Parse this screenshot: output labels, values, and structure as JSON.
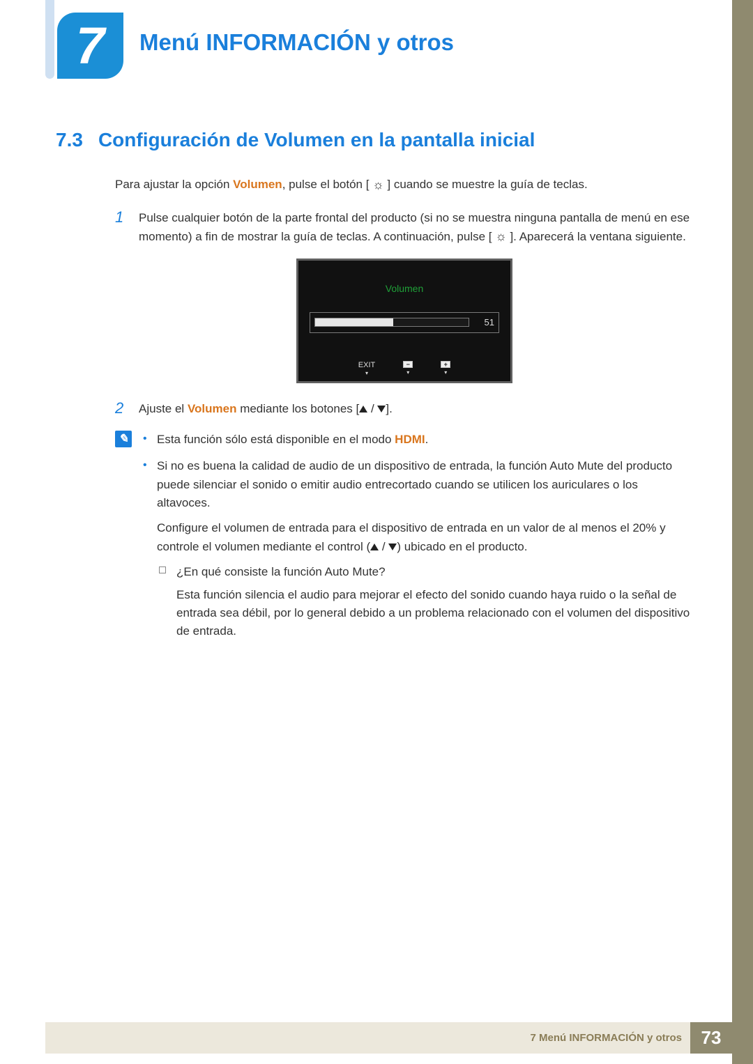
{
  "chapter": {
    "number": "7",
    "title": "Menú INFORMACIÓN y otros"
  },
  "section": {
    "number": "7.3",
    "title": "Configuración de Volumen en la pantalla inicial"
  },
  "intro": {
    "prefix": "Para ajustar la opción ",
    "volumen": "Volumen",
    "middle": ", pulse el botón [ ",
    "suffix": " ] cuando se muestre la guía de teclas."
  },
  "steps": {
    "s1": {
      "num": "1",
      "t1": "Pulse cualquier botón de la parte frontal del producto (si no se muestra ninguna pantalla de menú en ese momento) a fin de mostrar la guía de teclas. A continuación, pulse [ ",
      "t2": " ]. Aparecerá la ventana siguiente."
    },
    "s2": {
      "num": "2",
      "t1": "Ajuste el ",
      "volumen": "Volumen",
      "t2": " mediante los botones [",
      "slash": " / ",
      "t3": "]."
    }
  },
  "osd": {
    "title": "Volumen",
    "value": "51",
    "fill_percent": 51,
    "exit": "EXIT",
    "minus": "−",
    "plus": "+"
  },
  "notes": {
    "b1a": "Esta función sólo está disponible en el modo ",
    "b1b": "HDMI",
    "b1c": ".",
    "b2": "Si no es buena la calidad de audio de un dispositivo de entrada, la función Auto Mute del producto puede silenciar el sonido o emitir audio entrecortado cuando se utilicen los auriculares o los altavoces.",
    "b2p2a": "Configure el volumen de entrada para el dispositivo de entrada en un valor de al menos el 20% y controle el volumen mediante el control (",
    "b2p2b": ") ubicado en el producto.",
    "sub_q": "¿En qué consiste la función Auto Mute?",
    "sub_a": "Esta función silencia el audio para mejorar el efecto del sonido cuando haya ruido o la señal de entrada sea débil, por lo general debido a un problema relacionado con el volumen del dispositivo de entrada."
  },
  "footer": {
    "text": "7 Menú INFORMACIÓN y otros",
    "page": "73"
  }
}
